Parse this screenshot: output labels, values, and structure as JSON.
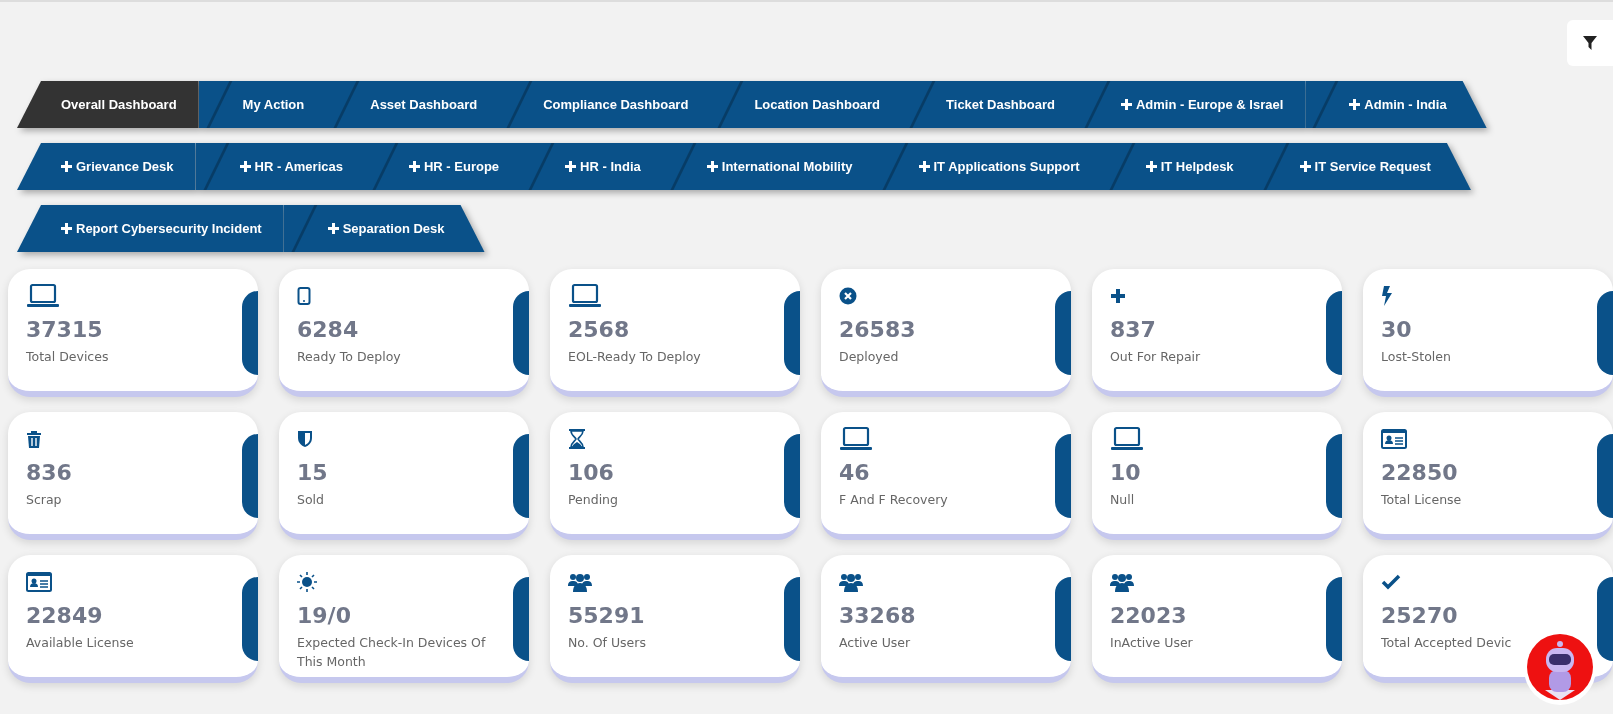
{
  "tab_rows": [
    [
      {
        "label": "Overall Dashboard",
        "kind": "plain",
        "selected": true
      },
      {
        "label": "My Action",
        "kind": "plain",
        "selected": false
      },
      {
        "label": "Asset Dashboard",
        "kind": "plain",
        "selected": false
      },
      {
        "label": "Compliance Dashboard",
        "kind": "plain",
        "selected": false
      },
      {
        "label": "Location Dashboard",
        "kind": "plain",
        "selected": false
      },
      {
        "label": "Ticket Dashboard",
        "kind": "plain",
        "selected": false
      },
      {
        "label": "Admin - Europe & Israel",
        "kind": "plus",
        "selected": false
      },
      {
        "label": "Admin - India",
        "kind": "plus",
        "selected": false
      }
    ],
    [
      {
        "label": "Grievance Desk",
        "kind": "plus",
        "selected": false
      },
      {
        "label": "HR - Americas",
        "kind": "plus",
        "selected": false
      },
      {
        "label": "HR - Europe",
        "kind": "plus",
        "selected": false
      },
      {
        "label": "HR - India",
        "kind": "plus",
        "selected": false
      },
      {
        "label": "International Mobility",
        "kind": "plus",
        "selected": false
      },
      {
        "label": "IT Applications Support",
        "kind": "plus",
        "selected": false
      },
      {
        "label": "IT Helpdesk",
        "kind": "plus",
        "selected": false
      },
      {
        "label": "IT Service Request",
        "kind": "plus",
        "selected": false
      }
    ],
    [
      {
        "label": "Report Cybersecurity Incident",
        "kind": "plus",
        "selected": false
      },
      {
        "label": "Separation Desk",
        "kind": "plus",
        "selected": false
      }
    ]
  ],
  "cards": [
    {
      "kind": "laptop",
      "value": "37315",
      "label": "Total Devices"
    },
    {
      "kind": "tablet",
      "value": "6284",
      "label": "Ready To Deploy"
    },
    {
      "kind": "laptop",
      "value": "2568",
      "label": "EOL-Ready To Deploy"
    },
    {
      "kind": "cross-circle",
      "value": "26583",
      "label": "Deployed"
    },
    {
      "kind": "plus",
      "value": "837",
      "label": "Out For Repair"
    },
    {
      "kind": "bolt",
      "value": "30",
      "label": "Lost-Stolen"
    },
    {
      "kind": "trash",
      "value": "836",
      "label": "Scrap"
    },
    {
      "kind": "shield",
      "value": "15",
      "label": "Sold"
    },
    {
      "kind": "hourglass",
      "value": "106",
      "label": "Pending"
    },
    {
      "kind": "laptop",
      "value": "46",
      "label": "F And F Recovery"
    },
    {
      "kind": "laptop",
      "value": "10",
      "label": "Null"
    },
    {
      "kind": "id-card",
      "value": "22850",
      "label": "Total License"
    },
    {
      "kind": "id-card",
      "value": "22849",
      "label": "Available License"
    },
    {
      "kind": "sun",
      "value": "19/0",
      "label": "Expected Check-In Devices Of This Month"
    },
    {
      "kind": "users",
      "value": "55291",
      "label": "No. Of Users"
    },
    {
      "kind": "users",
      "value": "33268",
      "label": "Active User"
    },
    {
      "kind": "users",
      "value": "22023",
      "label": "InActive User"
    },
    {
      "kind": "check",
      "value": "25270",
      "label": "Total Accepted Devic"
    }
  ]
}
